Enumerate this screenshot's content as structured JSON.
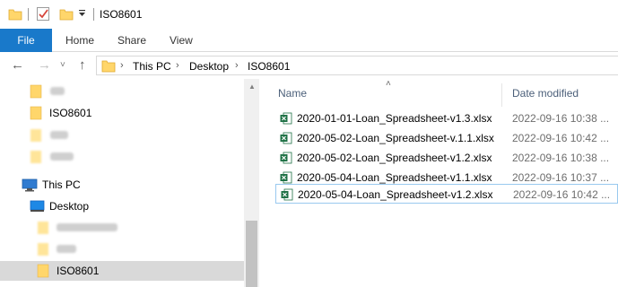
{
  "window": {
    "title": "ISO8601",
    "quick_access": [
      "folder-icon",
      "properties-check-icon",
      "new-folder-icon",
      "customize-arrow-icon"
    ]
  },
  "ribbon": {
    "tabs": [
      "File",
      "Home",
      "Share",
      "View"
    ]
  },
  "navigation": {
    "back_icon": "←",
    "forward_icon": "→",
    "recent_icon": "˅",
    "up_icon": "↑",
    "breadcrumb": [
      "This PC",
      "Desktop",
      "ISO8601"
    ],
    "breadcrumb_sep": "›"
  },
  "sidebar": {
    "items": [
      {
        "label": "",
        "blurred": true,
        "icon": "folder-icon"
      },
      {
        "label": "ISO8601",
        "blurred": false,
        "icon": "folder-icon"
      },
      {
        "label": "",
        "blurred": true,
        "icon": "folder-icon"
      },
      {
        "label": "",
        "blurred": true,
        "icon": "folder-icon"
      },
      {
        "label": "This PC",
        "blurred": false,
        "icon": "computer-icon"
      },
      {
        "label": "Desktop",
        "blurred": false,
        "icon": "desktop-icon"
      },
      {
        "label": "",
        "blurred": true,
        "icon": "folder-icon"
      },
      {
        "label": "",
        "blurred": true,
        "icon": "folder-icon"
      },
      {
        "label": "ISO8601",
        "blurred": false,
        "icon": "folder-icon",
        "selected": true
      }
    ]
  },
  "file_list": {
    "columns": {
      "name": "Name",
      "date": "Date modified"
    },
    "sort_indicator": "˄",
    "files": [
      {
        "name": "2020-01-01-Loan_Spreadsheet-v1.3.xlsx",
        "date": "2022-09-16 10:38 ..."
      },
      {
        "name": "2020-05-02-Loan_Spreadsheet-v.1.1.xlsx",
        "date": "2022-09-16 10:42 ..."
      },
      {
        "name": "2020-05-02-Loan_Spreadsheet-v1.2.xlsx",
        "date": "2022-09-16 10:38 ..."
      },
      {
        "name": "2020-05-04-Loan_Spreadsheet-v1.1.xlsx",
        "date": "2022-09-16 10:37 ..."
      },
      {
        "name": "2020-05-04-Loan_Spreadsheet-v1.2.xlsx",
        "date": "2022-09-16 10:42 ..."
      }
    ],
    "selected_index": 4
  },
  "colors": {
    "file_tab": "#1979ca",
    "folder": "#ffd66b",
    "excel": "#1e7145",
    "header_text": "#4c607a",
    "selection_border": "#99c9ef"
  }
}
